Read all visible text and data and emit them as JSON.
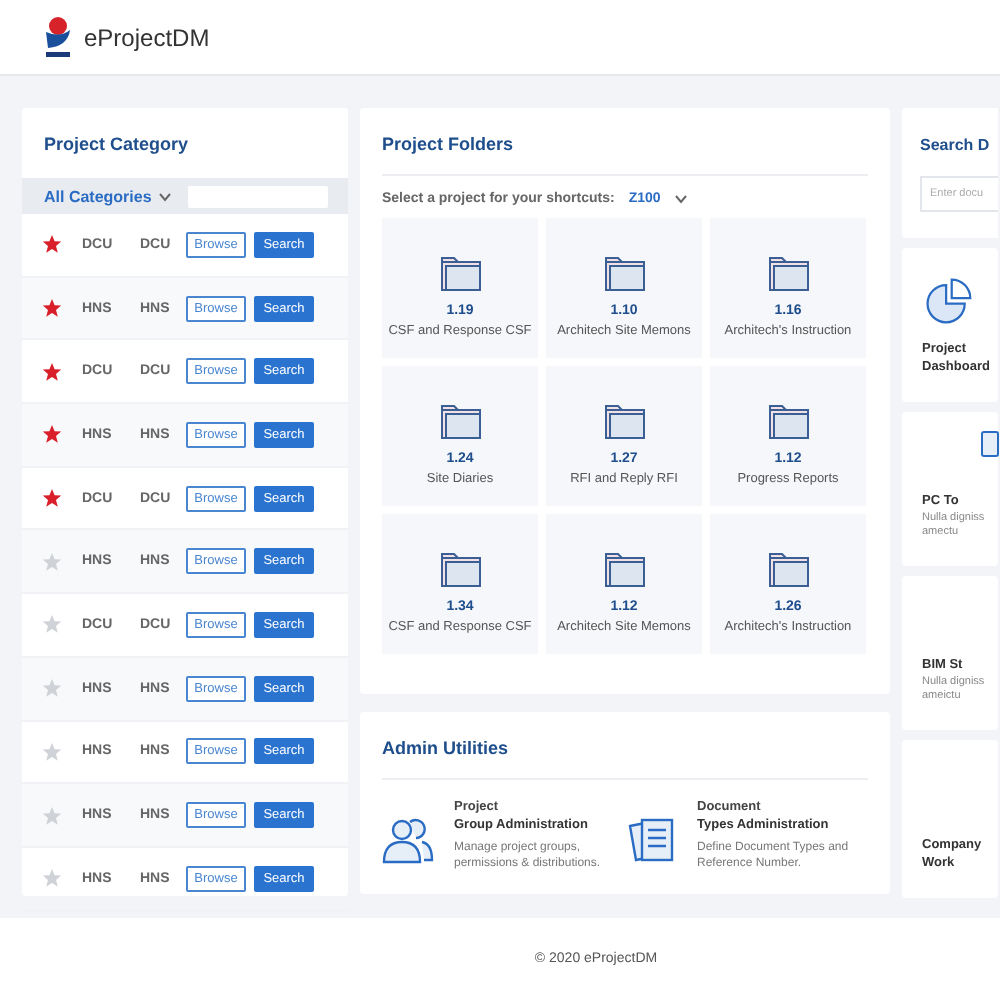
{
  "header": {
    "brand": "eProjectDM"
  },
  "category": {
    "title": "Project Category",
    "filter": "All Categories",
    "rows": [
      {
        "starred": true,
        "code": "DCU",
        "name": "DCU",
        "browse": "Browse",
        "search": "Search"
      },
      {
        "starred": true,
        "code": "HNS",
        "name": "HNS",
        "browse": "Browse",
        "search": "Search"
      },
      {
        "starred": true,
        "code": "DCU",
        "name": "DCU",
        "browse": "Browse",
        "search": "Search"
      },
      {
        "starred": true,
        "code": "HNS",
        "name": "HNS",
        "browse": "Browse",
        "search": "Search"
      },
      {
        "starred": true,
        "code": "DCU",
        "name": "DCU",
        "browse": "Browse",
        "search": "Search"
      },
      {
        "starred": false,
        "code": "HNS",
        "name": "HNS",
        "browse": "Browse",
        "search": "Search"
      },
      {
        "starred": false,
        "code": "DCU",
        "name": "DCU",
        "browse": "Browse",
        "search": "Search"
      },
      {
        "starred": false,
        "code": "HNS",
        "name": "HNS",
        "browse": "Browse",
        "search": "Search"
      },
      {
        "starred": false,
        "code": "HNS",
        "name": "HNS",
        "browse": "Browse",
        "search": "Search"
      },
      {
        "starred": false,
        "code": "HNS",
        "name": "HNS",
        "browse": "Browse",
        "search": "Search"
      },
      {
        "starred": false,
        "code": "HNS",
        "name": "HNS",
        "browse": "Browse",
        "search": "Search"
      }
    ]
  },
  "folders": {
    "title": "Project Folders",
    "prompt": "Select a project for your shortcuts:",
    "project": "Z100",
    "tiles": [
      {
        "number": "1.19",
        "label": "CSF and Response CSF"
      },
      {
        "number": "1.10",
        "label": "Architech Site Memons"
      },
      {
        "number": "1.16",
        "label": "Architech's Instruction"
      },
      {
        "number": "1.24",
        "label": "Site Diaries"
      },
      {
        "number": "1.27",
        "label": "RFI and Reply RFI"
      },
      {
        "number": "1.12",
        "label": "Progress Reports"
      },
      {
        "number": "1.34",
        "label": "CSF and Response CSF"
      },
      {
        "number": "1.12",
        "label": "Architech Site Memons"
      },
      {
        "number": "1.26",
        "label": "Architech's Instruction"
      }
    ]
  },
  "admin": {
    "title": "Admin Utilities",
    "items": [
      {
        "kind": "group",
        "title_top": "Project",
        "title": "Group Administration",
        "description": "Manage project groups, permissions & distributions."
      },
      {
        "kind": "document",
        "title_top": "Document",
        "title": "Types Administration",
        "description": "Define Document Types and Reference Number."
      }
    ]
  },
  "right": {
    "search": {
      "title": "Search D",
      "placeholder": "Enter docu"
    },
    "cards": [
      {
        "kind": "dashboard",
        "title_lines": [
          "Project",
          "Dashboard"
        ]
      },
      {
        "kind": "device",
        "title_lines": [
          "PC To"
        ],
        "lines": [
          "Nulla digniss",
          "amectu"
        ]
      },
      {
        "kind": "plain",
        "title_lines": [
          "BIM St"
        ],
        "lines": [
          "Nulla digniss",
          "ameictu"
        ]
      },
      {
        "kind": "plain",
        "title_lines": [
          "Company",
          "Work"
        ]
      }
    ]
  },
  "footer": "© 2020 eProjectDM"
}
